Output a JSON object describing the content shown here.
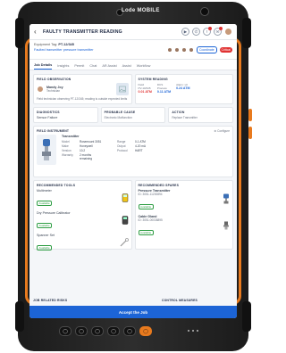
{
  "device": {
    "brand": "Lode MOBILE"
  },
  "header": {
    "title": "FAULTY TRANSMITTER READING"
  },
  "equipment": {
    "tag_label": "Equipment Tag:",
    "tag_value": "PT-12/345",
    "subtitle": "Faulted transmitter pressure transmitter",
    "pill": "Coordinate",
    "critical": "Critical"
  },
  "tabs": [
    "Job Details",
    "Insights",
    "Permit",
    "Chat",
    "AR Assist",
    "Assist",
    "Workflow"
  ],
  "field_observation": {
    "title": "FIELD OBSERVATION",
    "person": "Mandy Joy",
    "role": "Technician",
    "note": "Field technician observing PT-12/345; reading is outside expected limits"
  },
  "system_reading": {
    "title": "SYSTEM READING",
    "cols": [
      {
        "label": "Field",
        "sub": "PV-10/345",
        "value": "0.01 ATM"
      },
      {
        "label": "DCS",
        "sub": "Process",
        "value": "0.11 ATM"
      },
      {
        "label": "Alarm: HI",
        "sub": "",
        "value": "0.24 ATM"
      }
    ]
  },
  "diagnostics": {
    "title": "DIAGNOSTICS",
    "value": "Sensor Failure"
  },
  "probable_cause": {
    "title": "PROBABLE CAUSE",
    "value": "Electronic Malfunction"
  },
  "action": {
    "title": "ACTION",
    "value": "Replace Transmitter"
  },
  "field_instrument": {
    "title": "FIELD INSTRUMENT",
    "configure": "Configure",
    "name": "Transmitter",
    "specs_left": [
      {
        "k": "Model",
        "v": "Rosemount 3051"
      },
      {
        "k": "Make",
        "v": "Honeywell"
      },
      {
        "k": "Version",
        "v": "10.2"
      },
      {
        "k": "Warranty",
        "v": "2 months remaining"
      }
    ],
    "specs_right": [
      {
        "k": "Range",
        "v": "0-1 ATM"
      },
      {
        "k": "Output",
        "v": "4-20 mA"
      },
      {
        "k": "Protocol",
        "v": "HART"
      }
    ]
  },
  "tools": {
    "title": "RECOMMENDED TOOLS",
    "items": [
      {
        "name": "Multimeter",
        "status": "Available"
      },
      {
        "name": "Dry Pressure Calibrator",
        "status": "Available"
      },
      {
        "name": "Spanner Set",
        "status": "Available"
      }
    ]
  },
  "spares": {
    "title": "RECOMMENDED SPARES",
    "items": [
      {
        "name": "Pressure Transmitter",
        "id": "ID: 3051-11200894",
        "status": "Available"
      },
      {
        "name": "Cable Gland",
        "id": "ID: 3051-00038895",
        "status": "Available"
      }
    ]
  },
  "lower": {
    "left": "JOB RELATED RISKS",
    "right": "CONTROL MEASURES"
  },
  "accept_label": "Accept the Job",
  "keys": [
    "◯",
    "◯",
    "◯",
    "◯",
    "◯",
    "◯"
  ]
}
